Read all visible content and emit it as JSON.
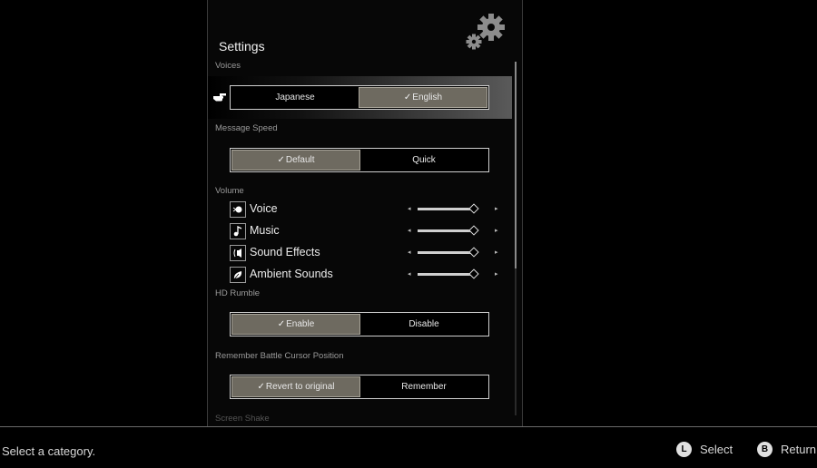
{
  "settings": {
    "title": "Settings",
    "sections": {
      "voices": "Voices",
      "message_speed": "Message Speed",
      "volume": "Volume",
      "hd_rumble": "HD Rumble",
      "battle_cursor": "Remember Battle Cursor Position",
      "cutoff": "Screen Shake"
    },
    "voices": {
      "options": [
        "Japanese",
        "English"
      ],
      "selected": "English"
    },
    "message_speed": {
      "options": [
        "Default",
        "Quick"
      ],
      "selected": "Default"
    },
    "hd_rumble": {
      "options": [
        "Enable",
        "Disable"
      ],
      "selected": "Enable"
    },
    "battle_cursor": {
      "options": [
        "Revert to original",
        "Remember"
      ],
      "selected": "Revert to original"
    },
    "volume": [
      {
        "label": "Voice",
        "icon": "voice-icon",
        "level": 1.0
      },
      {
        "label": "Music",
        "icon": "music-note-icon",
        "level": 1.0
      },
      {
        "label": "Sound Effects",
        "icon": "sound-effects-icon",
        "level": 1.0
      },
      {
        "label": "Ambient Sounds",
        "icon": "leaf-icon",
        "level": 1.0
      }
    ],
    "check_mark": "✓",
    "arrow_left": "◂",
    "arrow_right": "▸"
  },
  "footer": {
    "hint": "Select a category.",
    "buttons": [
      {
        "key": "L",
        "label": "Select"
      },
      {
        "key": "B",
        "label": "Return"
      }
    ]
  }
}
